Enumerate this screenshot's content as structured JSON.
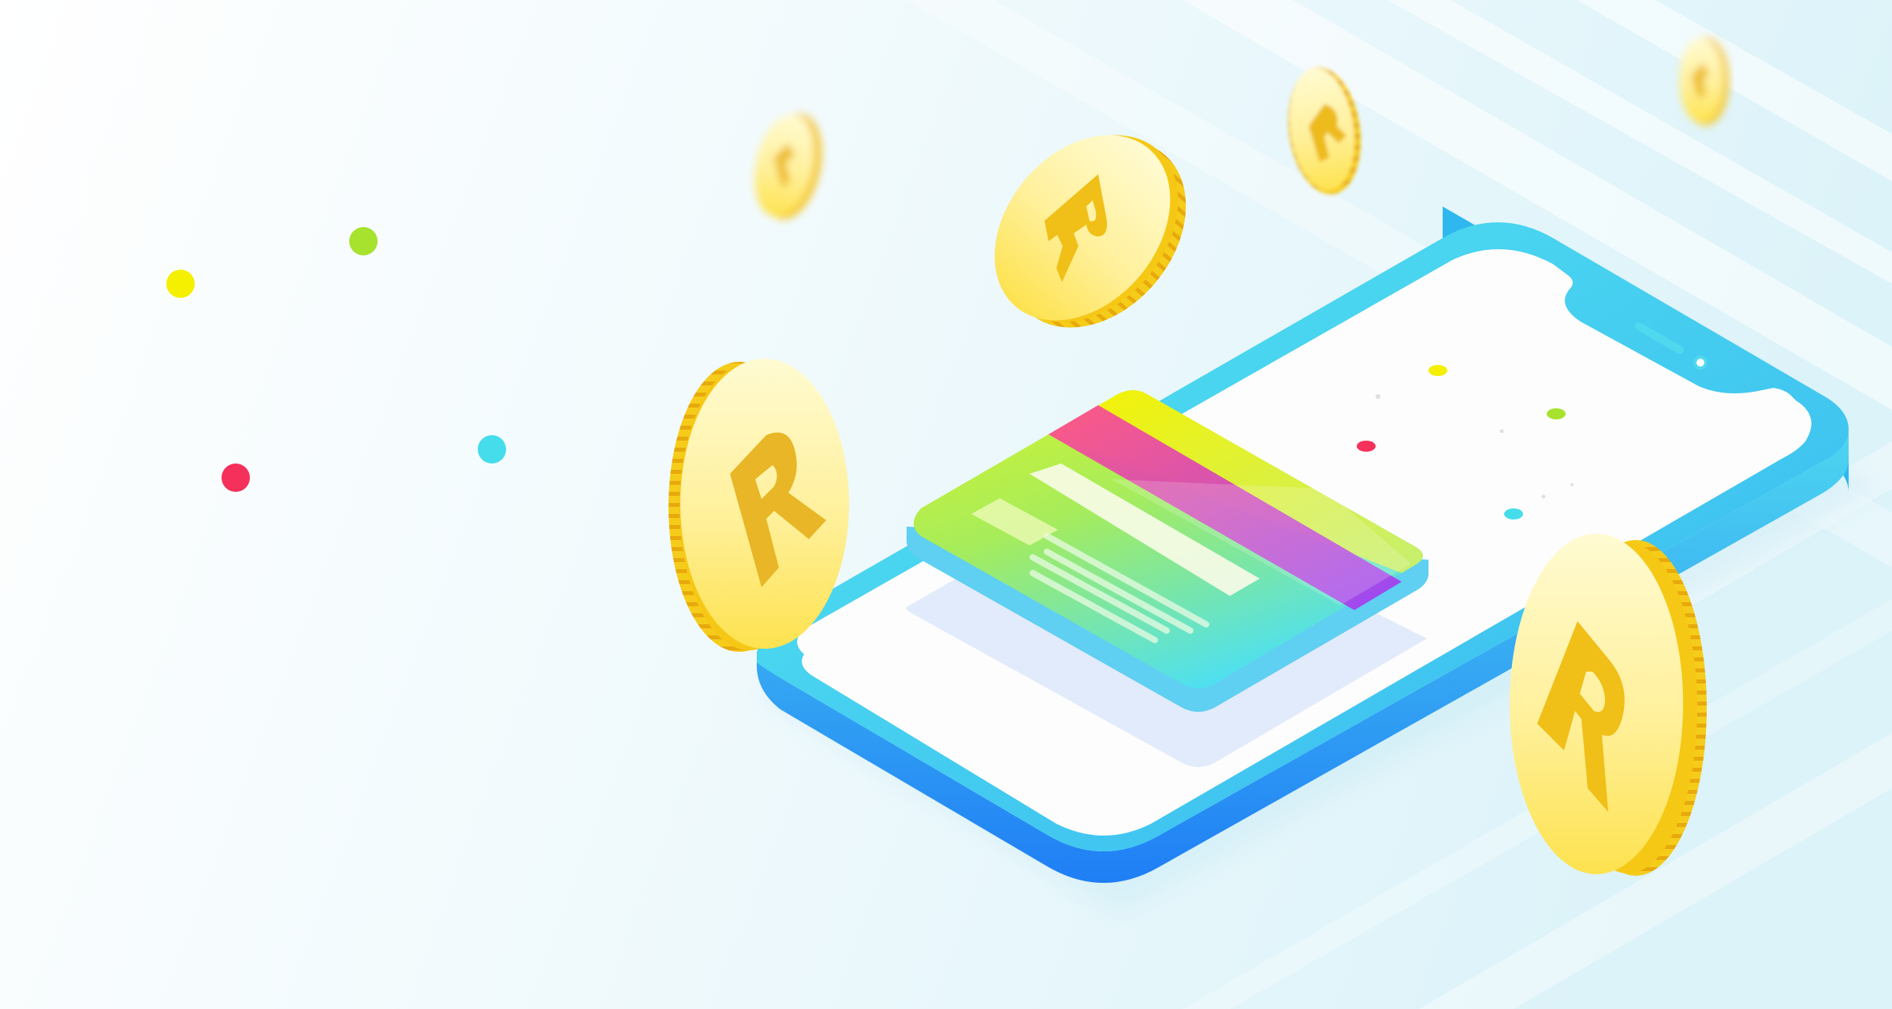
{
  "illustration": {
    "coin_symbol": "R",
    "colors": {
      "background_light": "#fdfeff",
      "background_tint": "#e3f5fa",
      "phone_body_top": "#52def0",
      "phone_body_bottom": "#1f7ef5",
      "phone_screen": "#fdfdfd",
      "coin_face_light": "#fff8c4",
      "coin_face_dark": "#fde35a",
      "coin_edge": "#f3c10f",
      "coin_symbol": "#edbb1c",
      "dot_yellow": "#f5ef00",
      "dot_green": "#a7e22e",
      "dot_red": "#f5305a",
      "dot_cyan": "#45dcec",
      "card_stripe_pink": "#ff4d8d",
      "card_stripe_purple": "#9f3df5",
      "card_green": "#b8f036",
      "card_cyan": "#47e0f0"
    }
  }
}
